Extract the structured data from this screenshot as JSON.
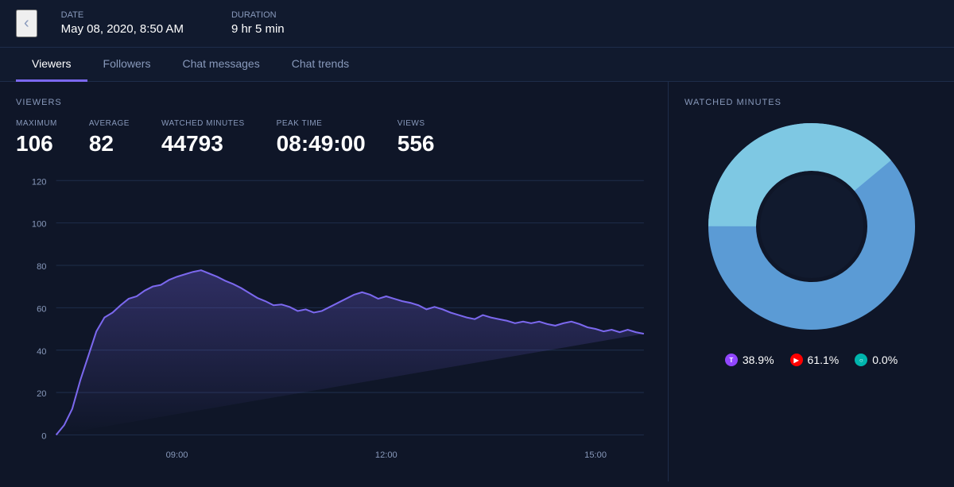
{
  "header": {
    "back_label": "‹",
    "date_label": "Date",
    "date_value": "May 08, 2020, 8:50 AM",
    "duration_label": "Duration",
    "duration_value": "9 hr 5 min"
  },
  "tabs": [
    {
      "id": "viewers",
      "label": "Viewers",
      "active": true
    },
    {
      "id": "followers",
      "label": "Followers",
      "active": false
    },
    {
      "id": "chat-messages",
      "label": "Chat messages",
      "active": false
    },
    {
      "id": "chat-trends",
      "label": "Chat trends",
      "active": false
    }
  ],
  "stats": {
    "section_label": "VIEWERS",
    "items": [
      {
        "label": "MAXIMUM",
        "value": "106"
      },
      {
        "label": "AVERAGE",
        "value": "82"
      },
      {
        "label": "WATCHED MINUTES",
        "value": "44793"
      },
      {
        "label": "PEAK TIME",
        "value": "08:49:00"
      },
      {
        "label": "VIEWS",
        "value": "556"
      }
    ]
  },
  "chart": {
    "y_labels": [
      "120",
      "100",
      "80",
      "60",
      "40",
      "20",
      "0"
    ],
    "x_labels": [
      "09:00",
      "12:00",
      "15:00"
    ]
  },
  "right_panel": {
    "label": "WATCHED MINUTES",
    "donut": {
      "twitch_pct": 38.9,
      "youtube_pct": 61.1,
      "other_pct": 0.0
    },
    "legend": [
      {
        "platform": "twitch",
        "label": "38.9%",
        "color": "#9146ff"
      },
      {
        "platform": "youtube",
        "label": "61.1%",
        "color": "#ff0000"
      },
      {
        "platform": "other",
        "label": "0.0%",
        "color": "#00b5ad"
      }
    ]
  }
}
